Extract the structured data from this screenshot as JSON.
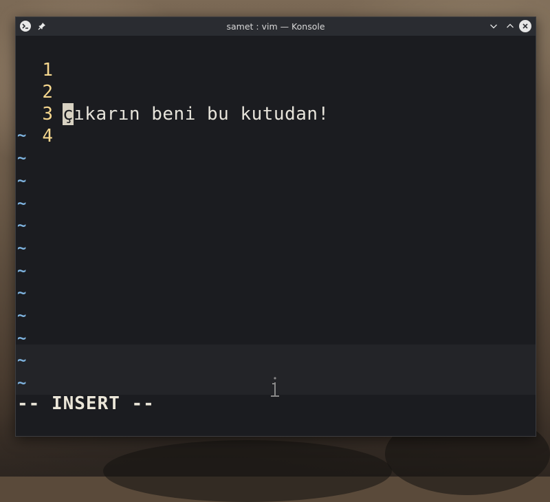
{
  "window": {
    "title": "samet : vim — Konsole"
  },
  "icons": {
    "app": "konsole-terminal-icon",
    "pin": "pin-icon",
    "minimize": "chevron-down-icon",
    "maximize": "chevron-up-icon",
    "close": "close-icon"
  },
  "editor": {
    "lines": [
      {
        "number": "1",
        "text": ""
      },
      {
        "number": "2",
        "text": "çıkarın beni bu kutudan!"
      },
      {
        "number": "3",
        "text": ""
      },
      {
        "number": "4",
        "text": ""
      }
    ],
    "cursor_char": "ç",
    "text_after_cursor": "ıkarın beni bu kutudan!",
    "empty_marker": "~",
    "mode": "-- INSERT --"
  },
  "colors": {
    "line_number": "#f6d78e",
    "tilde": "#7fb4e0",
    "text": "#e6e3da",
    "background": "#1b1c20"
  }
}
